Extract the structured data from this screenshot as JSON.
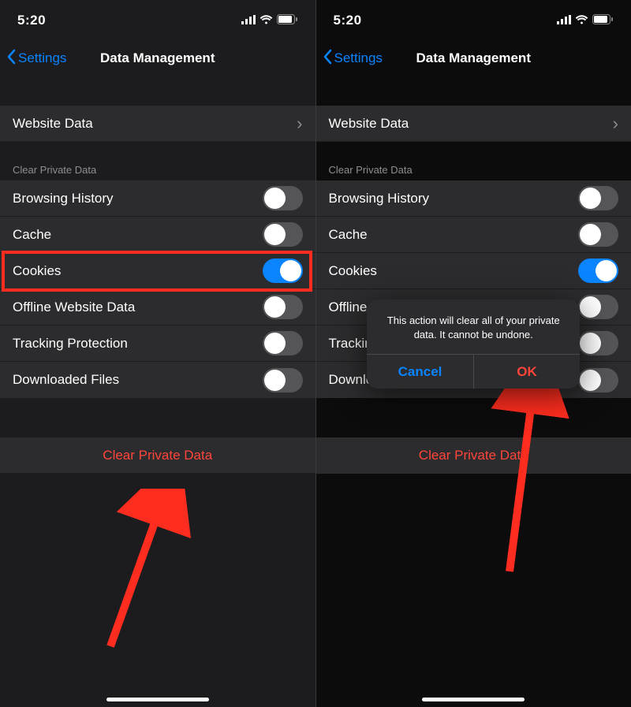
{
  "status": {
    "time": "5:20"
  },
  "nav": {
    "back": "Settings",
    "title": "Data Management"
  },
  "website_row": {
    "label": "Website Data"
  },
  "section_header": "Clear Private Data",
  "toggles": [
    {
      "label": "Browsing History",
      "state": "off"
    },
    {
      "label": "Cache",
      "state": "off"
    },
    {
      "label": "Cookies",
      "state": "on"
    },
    {
      "label": "Offline Website Data",
      "state": "off"
    },
    {
      "label": "Tracking Protection",
      "state": "off"
    },
    {
      "label": "Downloaded Files",
      "state": "off"
    }
  ],
  "action_button": "Clear Private Data",
  "alert": {
    "message": "This action will clear all of your private data. It cannot be undone.",
    "cancel": "Cancel",
    "ok": "OK"
  }
}
